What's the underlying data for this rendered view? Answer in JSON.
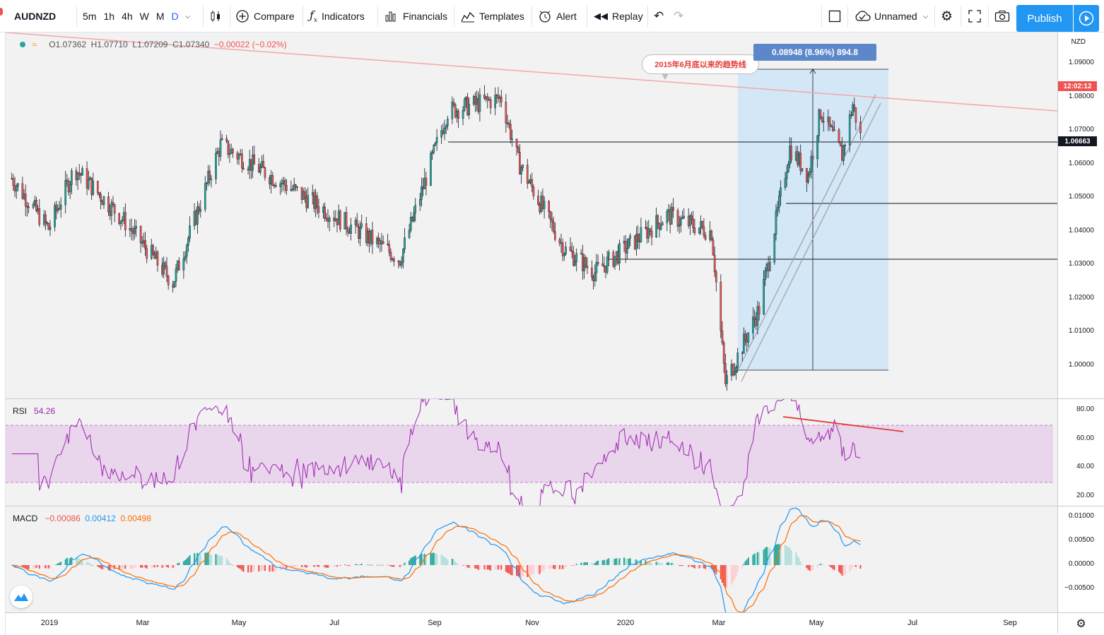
{
  "toolbar": {
    "symbol": "AUDNZD",
    "timeframes": [
      "5m",
      "1h",
      "4h",
      "W",
      "M",
      "D"
    ],
    "compare": "Compare",
    "indicators": "Indicators",
    "financials": "Financials",
    "templates": "Templates",
    "alert": "Alert",
    "replay": "Replay",
    "layout_name": "Unnamed",
    "publish": "Publish"
  },
  "legend": {
    "open": "O1.07362",
    "high": "H1.07710",
    "low": "L1.07209",
    "close": "C1.07340",
    "change": "−0.00022 (−0.02%)"
  },
  "annotations": {
    "trendline_note": "2015年6月底以来的趋势线",
    "measure": "0.08948 (8.96%) 894.8"
  },
  "price_axis": {
    "currency": "NZD",
    "labels": [
      "1.09000",
      "1.08000",
      "1.07000",
      "1.06000",
      "1.05000",
      "1.04000",
      "1.03000",
      "1.02000",
      "1.01000",
      "1.00000"
    ],
    "countdown": "12:02:12",
    "crosshair_price": "1.06663"
  },
  "rsi": {
    "label": "RSI",
    "value": "54.26",
    "axis": [
      "80.00",
      "60.00",
      "40.00",
      "20.00"
    ]
  },
  "macd": {
    "label": "MACD",
    "hist": "−0.00086",
    "macd": "0.00412",
    "signal": "0.00498",
    "axis": [
      "0.01000",
      "0.00500",
      "0.00000",
      "−0.00500"
    ]
  },
  "time_axis": [
    "2019",
    "Mar",
    "May",
    "Jul",
    "Sep",
    "Nov",
    "2020",
    "Mar",
    "May",
    "Jul",
    "Sep"
  ],
  "colors": {
    "up": "#26a69a",
    "down": "#ef5350",
    "accent": "#2196f3",
    "rsi_line": "#9c27b0",
    "macd_line": "#2196f3",
    "signal_line": "#ff6d00",
    "trendline": "#f4a7a7"
  },
  "chart_data": {
    "type": "candlestick",
    "symbol": "AUDNZD",
    "interval": "D",
    "ylim": [
      0.995,
      1.095
    ],
    "x_range": [
      "2018-12",
      "2020-09"
    ],
    "key_levels": [
      1.06663,
      1.048,
      1.0315
    ],
    "path_points": [
      {
        "date": "2018-12-10",
        "price": 1.061
      },
      {
        "date": "2019-01-03",
        "price": 1.046
      },
      {
        "date": "2019-01-20",
        "price": 1.064
      },
      {
        "date": "2019-02-20",
        "price": 1.049
      },
      {
        "date": "2019-03-25",
        "price": 1.03
      },
      {
        "date": "2019-04-25",
        "price": 1.071
      },
      {
        "date": "2019-06-10",
        "price": 1.058
      },
      {
        "date": "2019-07-25",
        "price": 1.045
      },
      {
        "date": "2019-08-20",
        "price": 1.037
      },
      {
        "date": "2019-09-10",
        "price": 1.067
      },
      {
        "date": "2019-09-20",
        "price": 1.081
      },
      {
        "date": "2019-10-25",
        "price": 1.085
      },
      {
        "date": "2019-11-05",
        "price": 1.066
      },
      {
        "date": "2019-12-05",
        "price": 1.04
      },
      {
        "date": "2019-12-25",
        "price": 1.033
      },
      {
        "date": "2020-02-10",
        "price": 1.05
      },
      {
        "date": "2020-03-10",
        "price": 1.045
      },
      {
        "date": "2020-03-19",
        "price": 1.0
      },
      {
        "date": "2020-04-10",
        "price": 1.022
      },
      {
        "date": "2020-04-30",
        "price": 1.07
      },
      {
        "date": "2020-05-12",
        "price": 1.062
      },
      {
        "date": "2020-05-20",
        "price": 1.081
      },
      {
        "date": "2020-06-03",
        "price": 1.068
      },
      {
        "date": "2020-06-10",
        "price": 1.083
      },
      {
        "date": "2020-06-15",
        "price": 1.0734
      }
    ],
    "rsi_current": 54.26,
    "rsi_bands": [
      70,
      30
    ],
    "macd_current": {
      "hist": -0.00086,
      "macd": 0.00412,
      "signal": 0.00498
    }
  }
}
